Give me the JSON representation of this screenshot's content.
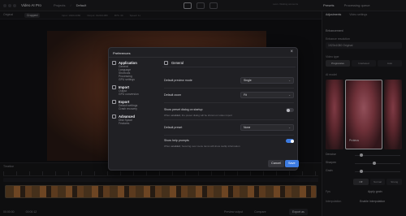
{
  "titlebar": {
    "app_title": "Video AI Pro",
    "breadcrumb": [
      "Projects",
      "Default"
    ],
    "right_info": "Last • Waiting accounts",
    "right_tabs": [
      "Presets",
      "Processing queue"
    ]
  },
  "subbar": {
    "chip1": "Original",
    "chip2": "Cropped",
    "infos": [
      "Input: 1920x1080",
      "Output: 1920x1080",
      "FPS: 30",
      "Speed: 1x"
    ]
  },
  "timeline": {
    "label": "Timeline",
    "footer_left": [
      "00:00:00",
      "00:00:12"
    ],
    "footer_right": [
      "Preview output",
      "Compare"
    ],
    "export_label": "Export as"
  },
  "rpanel": {
    "tabs": [
      "Adjustments",
      "Video settings"
    ],
    "enhancement_label": "Enhancement",
    "enhancement_field_label": "Enhance resolution",
    "enhancement_value": "1920x1080 Original",
    "video_type_label": "Video type",
    "video_type_options": [
      "Progressive",
      "Interlaced",
      "Auto"
    ],
    "model_label": "AI model",
    "thumb_caption": "Proteus",
    "sliders": [
      {
        "label": "Denoise",
        "value": 0.1
      },
      {
        "label": "Sharpen",
        "value": 0.4
      },
      {
        "label": "Grain",
        "value": 0.1
      }
    ],
    "seg2": [
      "Off",
      "Normal",
      "Strong"
    ],
    "bottom_rows": [
      {
        "label": "Fps",
        "value": "Apply grain"
      },
      {
        "label": "Interpolation",
        "value": "Enable Interpolation"
      }
    ]
  },
  "modal": {
    "title": "Preferences",
    "close_glyph": "×",
    "sections": [
      {
        "heading": "Application",
        "items": [
          "General",
          "Language",
          "Shortcuts",
          "Processing",
          "GPU settings"
        ]
      },
      {
        "heading": "Import",
        "items": [
          "Output",
          "GPU conversion"
        ]
      },
      {
        "heading": "Export",
        "items": [
          "Default settings",
          "Crash recovery"
        ]
      },
      {
        "heading": "Advanced",
        "items": [
          "Disk Space",
          "Features"
        ]
      }
    ],
    "content_title": "General",
    "settings": {
      "preview_mode": {
        "label": "Default preview mode",
        "value": "Single"
      },
      "zoom": {
        "label": "Default zoom",
        "value": "Fit"
      },
      "preset_dialog": {
        "label": "Show preset dialog on startup",
        "help_prefix": "When",
        "help_bold": "enabled",
        "help_suffix": ", the preset dialog will be shown on video import",
        "enabled": false
      },
      "default_preset": {
        "label": "Default preset",
        "value": "None"
      },
      "help_prompts": {
        "label": "Show help prompts",
        "help_prefix": "When",
        "help_bold": "enabled",
        "help_suffix": ", hovering over menu items will show tooltip information",
        "enabled": true
      }
    },
    "cancel_label": "Cancel",
    "save_label": "Save"
  }
}
